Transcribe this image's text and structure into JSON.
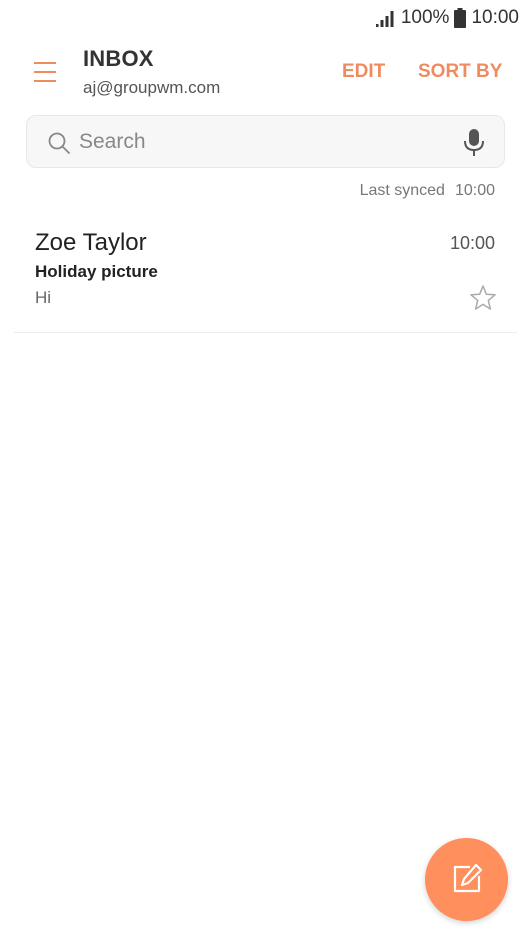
{
  "status_bar": {
    "battery_text": "100%",
    "time": "10:00",
    "icons": [
      "signal-icon",
      "battery-icon"
    ]
  },
  "header": {
    "title": "INBOX",
    "account": "aj@groupwm.com",
    "edit_label": "EDIT",
    "sort_label": "SORT BY",
    "menu_icon": "hamburger-menu-icon"
  },
  "search": {
    "placeholder": "Search",
    "value": "",
    "icons": [
      "search-icon",
      "microphone-icon"
    ]
  },
  "sync": {
    "label": "Last synced",
    "time": "10:00"
  },
  "emails": [
    {
      "sender": "Zoe Taylor",
      "time": "10:00",
      "subject": "Holiday picture",
      "preview": "Hi",
      "starred": false
    }
  ],
  "fab": {
    "icon": "compose-icon"
  },
  "colors": {
    "accent": "#f08b5f",
    "fab": "#ff8f5c",
    "background": "#ffffff"
  }
}
